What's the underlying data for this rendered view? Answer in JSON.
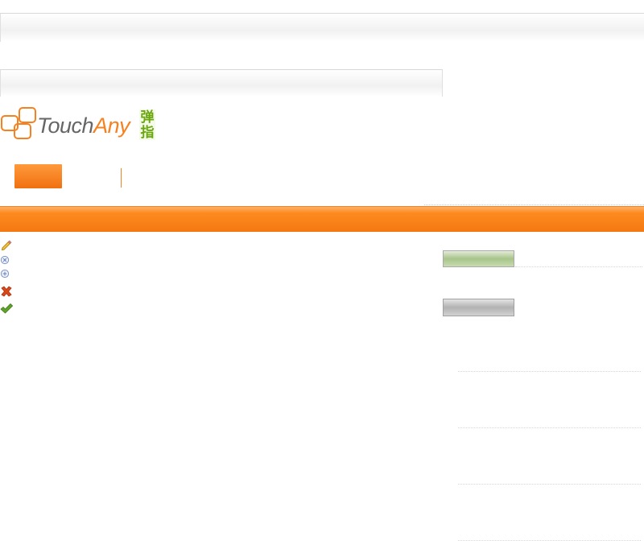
{
  "logo": {
    "text_primary": "Touch",
    "text_accent": "Any",
    "badge": "弹指",
    "brand_orange": "#f58220",
    "brand_green": "#6aa70f"
  },
  "toolbar_icons": [
    "pencil-icon",
    "cancel-circle-icon",
    "add-circle-icon",
    "delete-x-icon",
    "checkmark-icon"
  ],
  "colors": {
    "accent_band": "#f58220",
    "green_button": "#a8c48a",
    "grey_button": "#b2b2b2"
  }
}
